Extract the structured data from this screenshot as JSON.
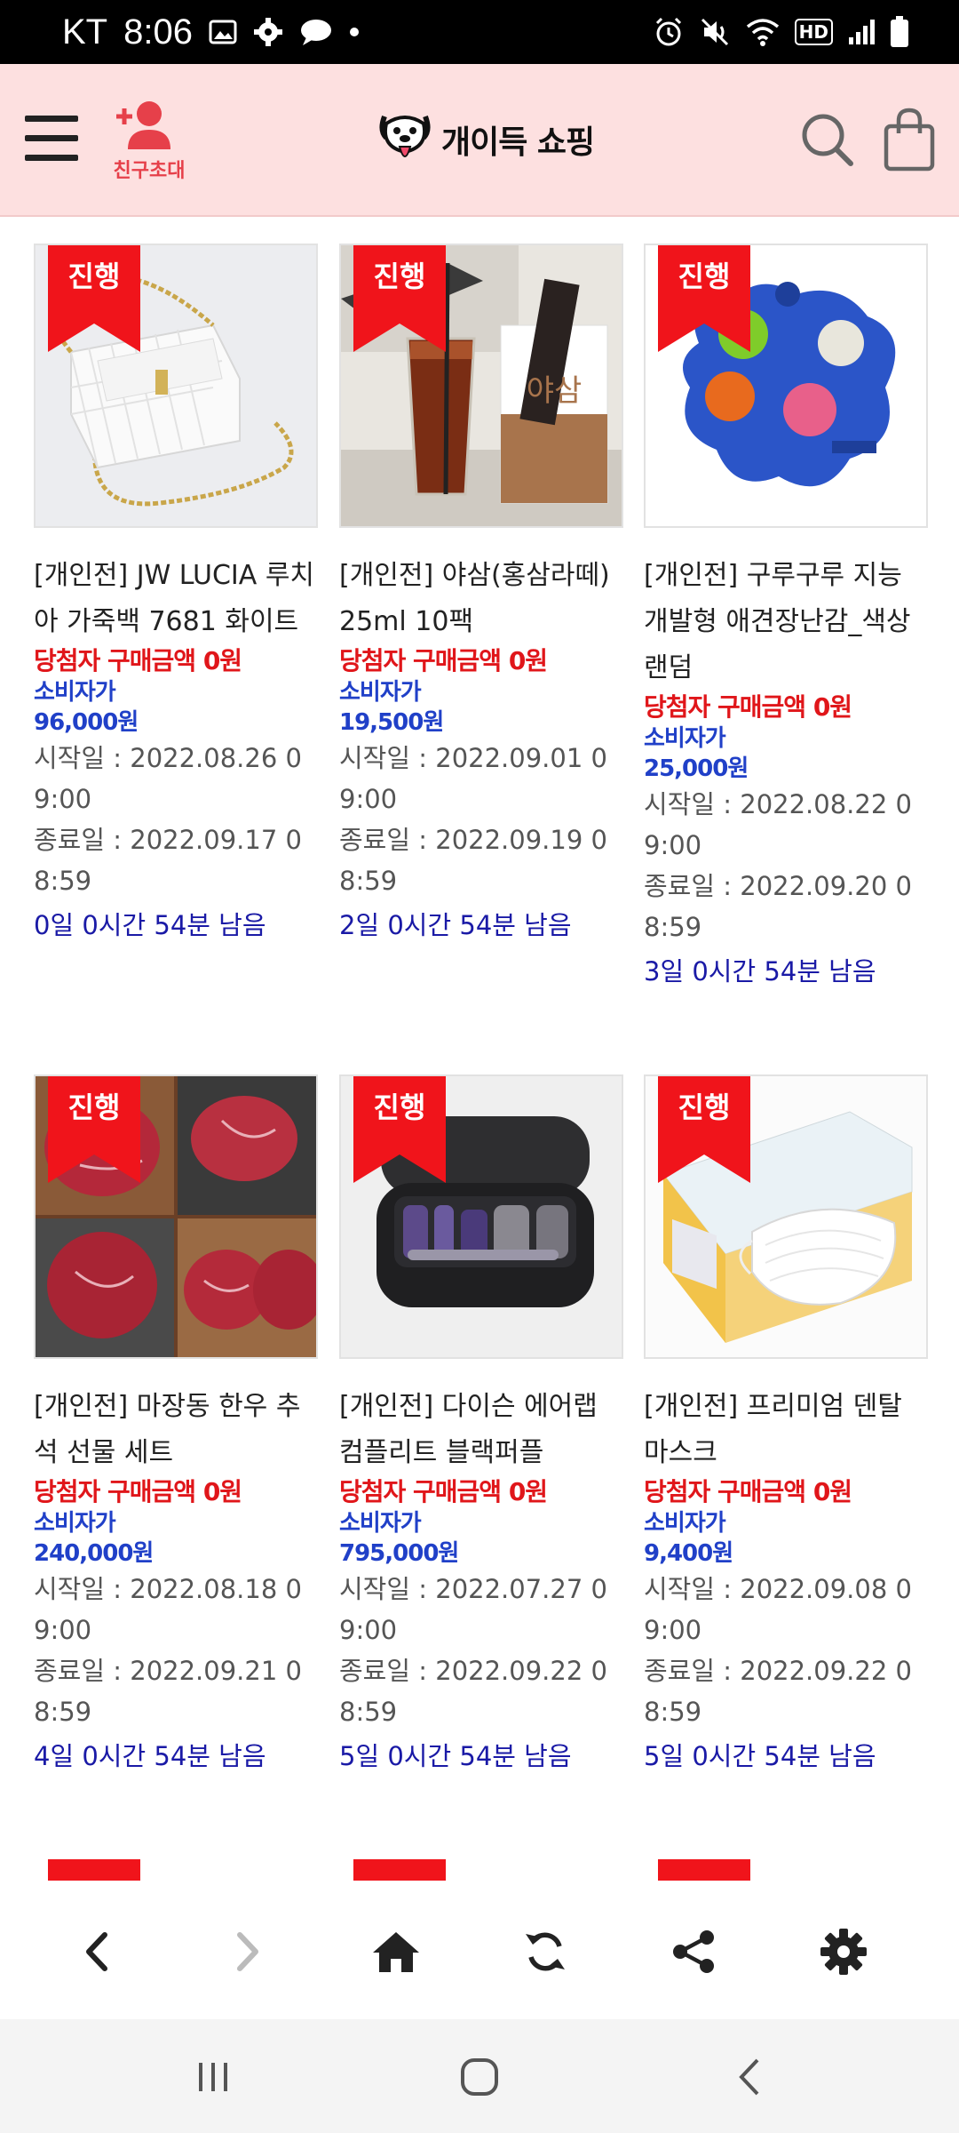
{
  "status_bar": {
    "carrier": "KT",
    "time": "8:06",
    "hd_label": "HD"
  },
  "header": {
    "invite_label": "친구초대",
    "logo_text": "개이득 쇼핑"
  },
  "badge_label": "진행",
  "products": [
    {
      "name": "[개인전] JW LUCIA 루치아 가죽백 7681 화이트",
      "winner_price": "당첨자 구매금액 0원",
      "retail_label": "소비자가",
      "retail_price": "96,000원",
      "start": "시작일 : 2022.08.26 09:00",
      "end": "종료일 : 2022.09.17 08:59",
      "remaining": "0일 0시간 54분 남음",
      "image": "white-quilted-handbag"
    },
    {
      "name": "[개인전] 야삼(홍삼라떼) 25ml 10팩",
      "winner_price": "당첨자 구매금액 0원",
      "retail_label": "소비자가",
      "retail_price": "19,500원",
      "start": "시작일 : 2022.09.01 09:00",
      "end": "종료일 : 2022.09.19 08:59",
      "remaining": "2일 0시간 54분 남음",
      "image": "iced-red-ginseng-latte-box",
      "image_text": "야삼"
    },
    {
      "name": "[개인전] 구루구루 지능개발형 애견장난감_색상랜덤",
      "winner_price": "당첨자 구매금액 0원",
      "retail_label": "소비자가",
      "retail_price": "25,000원",
      "start": "시작일 : 2022.08.22 09:00",
      "end": "종료일 : 2022.09.20 08:59",
      "remaining": "3일 0시간 54분 남음",
      "image": "blue-paw-puzzle-toy"
    },
    {
      "name": "[개인전] 마장동 한우 추석 선물 세트",
      "winner_price": "당첨자 구매금액 0원",
      "retail_label": "소비자가",
      "retail_price": "240,000원",
      "start": "시작일 : 2022.08.18 09:00",
      "end": "종료일 : 2022.09.21 08:59",
      "remaining": "4일 0시간 54분 남음",
      "image": "raw-hanwoo-beef-steaks"
    },
    {
      "name": "[개인전] 다이슨 에어랩 컴플리트 블랙퍼플",
      "winner_price": "당첨자 구매금액 0원",
      "retail_label": "소비자가",
      "retail_price": "795,000원",
      "start": "시작일 : 2022.07.27 09:00",
      "end": "종료일 : 2022.09.22 08:59",
      "remaining": "5일 0시간 54분 남음",
      "image": "dyson-airwrap-case"
    },
    {
      "name": "[개인전] 프리미엄 덴탈 마스크",
      "winner_price": "당첨자 구매금액 0원",
      "retail_label": "소비자가",
      "retail_price": "9,400원",
      "start": "시작일 : 2022.09.08 09:00",
      "end": "종료일 : 2022.09.22 08:59",
      "remaining": "5일 0시간 54분 남음",
      "image": "dental-mask-box"
    }
  ],
  "colors": {
    "header_bg": "#fde0e0",
    "badge_red": "#f0141b",
    "winner_red": "#e0161a",
    "retail_blue": "#2040c8",
    "remaining_navy": "#1a1aa6"
  },
  "icons": {
    "toolbar": [
      "back-icon",
      "forward-icon",
      "home-icon",
      "refresh-icon",
      "share-icon",
      "settings-icon"
    ],
    "nav": [
      "recent-apps-icon",
      "home-circle-icon",
      "back-chevron-icon"
    ]
  }
}
